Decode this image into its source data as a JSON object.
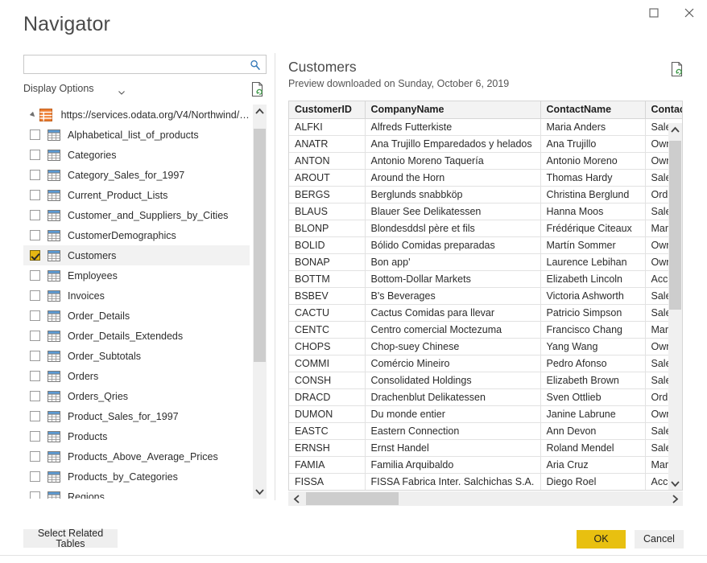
{
  "window": {
    "title": "Navigator",
    "maximize_label": "Maximize",
    "close_label": "Close"
  },
  "search": {
    "value": "",
    "placeholder": ""
  },
  "display_options": {
    "label": "Display Options"
  },
  "tree": {
    "root": {
      "label": "https://services.odata.org/V4/Northwind/N...",
      "expanded": true
    },
    "items": [
      {
        "label": "Alphabetical_list_of_products",
        "checked": false,
        "selected": false
      },
      {
        "label": "Categories",
        "checked": false,
        "selected": false
      },
      {
        "label": "Category_Sales_for_1997",
        "checked": false,
        "selected": false
      },
      {
        "label": "Current_Product_Lists",
        "checked": false,
        "selected": false
      },
      {
        "label": "Customer_and_Suppliers_by_Cities",
        "checked": false,
        "selected": false
      },
      {
        "label": "CustomerDemographics",
        "checked": false,
        "selected": false
      },
      {
        "label": "Customers",
        "checked": true,
        "selected": true
      },
      {
        "label": "Employees",
        "checked": false,
        "selected": false
      },
      {
        "label": "Invoices",
        "checked": false,
        "selected": false
      },
      {
        "label": "Order_Details",
        "checked": false,
        "selected": false
      },
      {
        "label": "Order_Details_Extendeds",
        "checked": false,
        "selected": false
      },
      {
        "label": "Order_Subtotals",
        "checked": false,
        "selected": false
      },
      {
        "label": "Orders",
        "checked": false,
        "selected": false
      },
      {
        "label": "Orders_Qries",
        "checked": false,
        "selected": false
      },
      {
        "label": "Product_Sales_for_1997",
        "checked": false,
        "selected": false
      },
      {
        "label": "Products",
        "checked": false,
        "selected": false
      },
      {
        "label": "Products_Above_Average_Prices",
        "checked": false,
        "selected": false
      },
      {
        "label": "Products_by_Categories",
        "checked": false,
        "selected": false
      },
      {
        "label": "Regions",
        "checked": false,
        "selected": false
      }
    ]
  },
  "preview": {
    "title": "Customers",
    "subtitle": "Preview downloaded on Sunday, October 6, 2019",
    "columns": [
      "CustomerID",
      "CompanyName",
      "ContactName",
      "ContactTitle"
    ],
    "rows": [
      [
        "ALFKI",
        "Alfreds Futterkiste",
        "Maria Anders",
        "Sales Representative"
      ],
      [
        "ANATR",
        "Ana Trujillo Emparedados y helados",
        "Ana Trujillo",
        "Owner"
      ],
      [
        "ANTON",
        "Antonio Moreno Taquería",
        "Antonio Moreno",
        "Owner"
      ],
      [
        "AROUT",
        "Around the Horn",
        "Thomas Hardy",
        "Sales Representative"
      ],
      [
        "BERGS",
        "Berglunds snabbköp",
        "Christina Berglund",
        "Order Administrator"
      ],
      [
        "BLAUS",
        "Blauer See Delikatessen",
        "Hanna Moos",
        "Sales Representative"
      ],
      [
        "BLONP",
        "Blondesddsl père et fils",
        "Frédérique Citeaux",
        "Marketing Manager"
      ],
      [
        "BOLID",
        "Bólido Comidas preparadas",
        "Martín Sommer",
        "Owner"
      ],
      [
        "BONAP",
        "Bon app'",
        "Laurence Lebihan",
        "Owner"
      ],
      [
        "BOTTM",
        "Bottom-Dollar Markets",
        "Elizabeth Lincoln",
        "Accounting Manager"
      ],
      [
        "BSBEV",
        "B's Beverages",
        "Victoria Ashworth",
        "Sales Representative"
      ],
      [
        "CACTU",
        "Cactus Comidas para llevar",
        "Patricio Simpson",
        "Sales Agent"
      ],
      [
        "CENTC",
        "Centro comercial Moctezuma",
        "Francisco Chang",
        "Marketing Manager"
      ],
      [
        "CHOPS",
        "Chop-suey Chinese",
        "Yang Wang",
        "Owner"
      ],
      [
        "COMMI",
        "Comércio Mineiro",
        "Pedro Afonso",
        "Sales Associate"
      ],
      [
        "CONSH",
        "Consolidated Holdings",
        "Elizabeth Brown",
        "Sales Representative"
      ],
      [
        "DRACD",
        "Drachenblut Delikatessen",
        "Sven Ottlieb",
        "Order Administrator"
      ],
      [
        "DUMON",
        "Du monde entier",
        "Janine Labrune",
        "Owner"
      ],
      [
        "EASTC",
        "Eastern Connection",
        "Ann Devon",
        "Sales Agent"
      ],
      [
        "ERNSH",
        "Ernst Handel",
        "Roland Mendel",
        "Sales Manager"
      ],
      [
        "FAMIA",
        "Familia Arquibaldo",
        "Aria Cruz",
        "Marketing Assistant"
      ],
      [
        "FISSA",
        "FISSA Fabrica Inter. Salchichas S.A.",
        "Diego Roel",
        "Accounting Manager"
      ]
    ]
  },
  "footer": {
    "select_related_tables": "Select Related Tables",
    "ok": "OK",
    "cancel": "Cancel"
  },
  "colors": {
    "accent_ok": "#e8c010",
    "checkbox_checked": "#e6b612",
    "root_icon": "#ed7d31",
    "table_icon": "#3a7ab5"
  }
}
